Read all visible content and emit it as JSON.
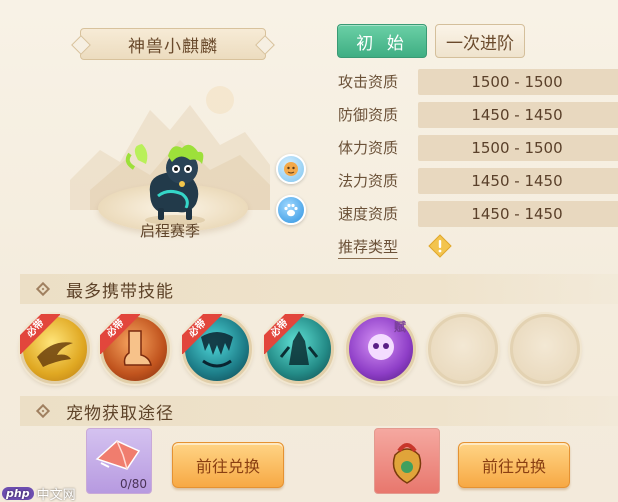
{
  "pet": {
    "name": "神兽小麒麟",
    "season": "启程赛季"
  },
  "tabs": {
    "initial": "初 始",
    "advance": "一次进阶"
  },
  "stats": [
    {
      "label": "攻击资质",
      "value": "1500 - 1500"
    },
    {
      "label": "防御资质",
      "value": "1450 - 1450"
    },
    {
      "label": "体力资质",
      "value": "1500 - 1500"
    },
    {
      "label": "法力资质",
      "value": "1450 - 1450"
    },
    {
      "label": "速度资质",
      "value": "1450 - 1450"
    }
  ],
  "recommend_label": "推荐类型",
  "skills_section": {
    "title": "最多携带技能",
    "must_tag": "必带",
    "fu_tag": "赋"
  },
  "acquire_section": {
    "title": "宠物获取途径",
    "item_count": "0/80",
    "exchange_label_1": "前往兑换",
    "exchange_label_2": "前往兑换"
  },
  "watermark": {
    "badge": "php",
    "text": "中文网"
  },
  "colors": {
    "accent_green": "#4fbf92",
    "exchange_orange": "#f7a944",
    "ribbon_red": "#e2463c"
  }
}
